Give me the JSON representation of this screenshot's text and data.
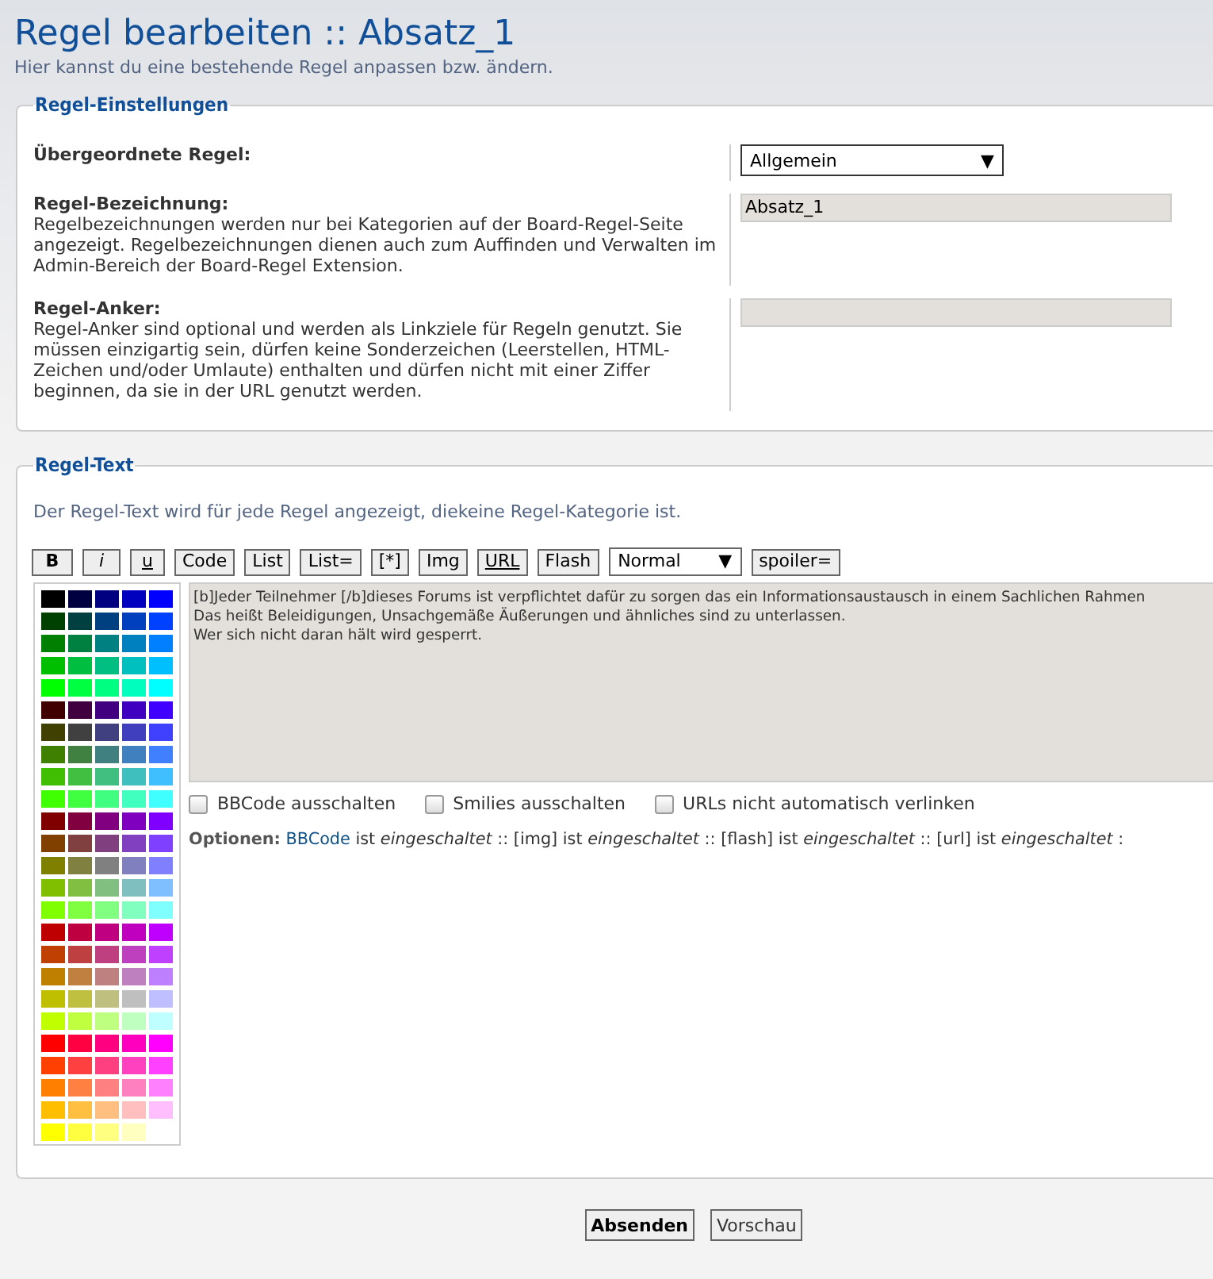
{
  "header": {
    "title": "Regel bearbeiten :: Absatz_1",
    "subtitle": "Hier kannst du eine bestehende Regel anpassen bzw. ändern."
  },
  "settings": {
    "legend": "Regel-Einstellungen",
    "rows": [
      {
        "kind": "select",
        "label": "Übergeordnete Regel:",
        "value": "Allgemein",
        "arrow": "▼"
      },
      {
        "kind": "text",
        "label": "Regel-Bezeichnung:",
        "explain": "Regelbezeichnungen werden nur bei Kategorien auf der Board-Regel-Seite angezeigt. Regelbezeichnungen dienen auch zum Auffinden und Verwalten im Admin-Bereich der Board-Regel Extension.",
        "value": "Absatz_1"
      },
      {
        "kind": "text",
        "label": "Regel-Anker:",
        "explain": "Regel-Anker sind optional und werden als Linkziele für Regeln genutzt. Sie müssen einzigartig sein, dürfen keine Sonderzeichen (Leerstellen, HTML-Zeichen und/oder Umlaute) enthalten und dürfen nicht mit einer Ziffer beginnen, da sie in der URL genutzt werden."
      }
    ]
  },
  "text_panel": {
    "legend": "Regel-Text",
    "explain": "Der Regel-Text wird für jede Regel angezeigt, diekeine Regel-Kategorie ist.",
    "toolbar": [
      {
        "kind": "bold",
        "label": "B"
      },
      {
        "kind": "italic",
        "label": "i"
      },
      {
        "kind": "underline",
        "label": "u"
      },
      {
        "kind": "plain",
        "label": "Code"
      },
      {
        "kind": "plain",
        "label": "List"
      },
      {
        "kind": "plain",
        "label": "List="
      },
      {
        "kind": "plain",
        "label": "[*]"
      },
      {
        "kind": "plain",
        "label": "Img"
      },
      {
        "kind": "underline",
        "label": "URL"
      },
      {
        "kind": "plain",
        "label": "Flash"
      },
      {
        "kind": "select",
        "label": "Normal",
        "arrow": "▼"
      },
      {
        "kind": "plain",
        "label": "spoiler="
      }
    ],
    "palette": [
      {
        "swatches": [
          {
            "color": "#000000"
          },
          {
            "color": "#000040"
          },
          {
            "color": "#000080"
          },
          {
            "color": "#0000bf"
          },
          {
            "color": "#0000ff"
          }
        ]
      },
      {
        "swatches": [
          {
            "color": "#004000"
          },
          {
            "color": "#004040"
          },
          {
            "color": "#004080"
          },
          {
            "color": "#0040bf"
          },
          {
            "color": "#0040ff"
          }
        ]
      },
      {
        "swatches": [
          {
            "color": "#008000"
          },
          {
            "color": "#008040"
          },
          {
            "color": "#008080"
          },
          {
            "color": "#0080bf"
          },
          {
            "color": "#0080ff"
          }
        ]
      },
      {
        "swatches": [
          {
            "color": "#00bf00"
          },
          {
            "color": "#00bf40"
          },
          {
            "color": "#00bf80"
          },
          {
            "color": "#00bfbf"
          },
          {
            "color": "#00bfff"
          }
        ]
      },
      {
        "swatches": [
          {
            "color": "#00ff00"
          },
          {
            "color": "#00ff40"
          },
          {
            "color": "#00ff80"
          },
          {
            "color": "#00ffbf"
          },
          {
            "color": "#00ffff"
          }
        ]
      },
      {
        "swatches": [
          {
            "color": "#400000"
          },
          {
            "color": "#400040"
          },
          {
            "color": "#400080"
          },
          {
            "color": "#4000bf"
          },
          {
            "color": "#4000ff"
          }
        ]
      },
      {
        "swatches": [
          {
            "color": "#404000"
          },
          {
            "color": "#404040"
          },
          {
            "color": "#404080"
          },
          {
            "color": "#4040bf"
          },
          {
            "color": "#4040ff"
          }
        ]
      },
      {
        "swatches": [
          {
            "color": "#408000"
          },
          {
            "color": "#408040"
          },
          {
            "color": "#408080"
          },
          {
            "color": "#4080bf"
          },
          {
            "color": "#4080ff"
          }
        ]
      },
      {
        "swatches": [
          {
            "color": "#40bf00"
          },
          {
            "color": "#40bf40"
          },
          {
            "color": "#40bf80"
          },
          {
            "color": "#40bfbf"
          },
          {
            "color": "#40bfff"
          }
        ]
      },
      {
        "swatches": [
          {
            "color": "#40ff00"
          },
          {
            "color": "#40ff40"
          },
          {
            "color": "#40ff80"
          },
          {
            "color": "#40ffbf"
          },
          {
            "color": "#40ffff"
          }
        ]
      },
      {
        "swatches": [
          {
            "color": "#800000"
          },
          {
            "color": "#800040"
          },
          {
            "color": "#800080"
          },
          {
            "color": "#8000bf"
          },
          {
            "color": "#8000ff"
          }
        ]
      },
      {
        "swatches": [
          {
            "color": "#804000"
          },
          {
            "color": "#804040"
          },
          {
            "color": "#804080"
          },
          {
            "color": "#8040bf"
          },
          {
            "color": "#8040ff"
          }
        ]
      },
      {
        "swatches": [
          {
            "color": "#808000"
          },
          {
            "color": "#808040"
          },
          {
            "color": "#808080"
          },
          {
            "color": "#8080bf"
          },
          {
            "color": "#8080ff"
          }
        ]
      },
      {
        "swatches": [
          {
            "color": "#80bf00"
          },
          {
            "color": "#80bf40"
          },
          {
            "color": "#80bf80"
          },
          {
            "color": "#80bfbf"
          },
          {
            "color": "#80bfff"
          }
        ]
      },
      {
        "swatches": [
          {
            "color": "#80ff00"
          },
          {
            "color": "#80ff40"
          },
          {
            "color": "#80ff80"
          },
          {
            "color": "#80ffbf"
          },
          {
            "color": "#80ffff"
          }
        ]
      },
      {
        "swatches": [
          {
            "color": "#bf0000"
          },
          {
            "color": "#bf0040"
          },
          {
            "color": "#bf0080"
          },
          {
            "color": "#bf00bf"
          },
          {
            "color": "#bf00ff"
          }
        ]
      },
      {
        "swatches": [
          {
            "color": "#bf4000"
          },
          {
            "color": "#bf4040"
          },
          {
            "color": "#bf4080"
          },
          {
            "color": "#bf40bf"
          },
          {
            "color": "#bf40ff"
          }
        ]
      },
      {
        "swatches": [
          {
            "color": "#bf8000"
          },
          {
            "color": "#bf8040"
          },
          {
            "color": "#bf8080"
          },
          {
            "color": "#bf80bf"
          },
          {
            "color": "#bf80ff"
          }
        ]
      },
      {
        "swatches": [
          {
            "color": "#bfbf00"
          },
          {
            "color": "#bfbf40"
          },
          {
            "color": "#bfbf80"
          },
          {
            "color": "#bfbfbf"
          },
          {
            "color": "#bfbfff"
          }
        ]
      },
      {
        "swatches": [
          {
            "color": "#bfff00"
          },
          {
            "color": "#bfff40"
          },
          {
            "color": "#bfff80"
          },
          {
            "color": "#bfffbf"
          },
          {
            "color": "#bfffff"
          }
        ]
      },
      {
        "swatches": [
          {
            "color": "#ff0000"
          },
          {
            "color": "#ff0040"
          },
          {
            "color": "#ff0080"
          },
          {
            "color": "#ff00bf"
          },
          {
            "color": "#ff00ff"
          }
        ]
      },
      {
        "swatches": [
          {
            "color": "#ff4000"
          },
          {
            "color": "#ff4040"
          },
          {
            "color": "#ff4080"
          },
          {
            "color": "#ff40bf"
          },
          {
            "color": "#ff40ff"
          }
        ]
      },
      {
        "swatches": [
          {
            "color": "#ff8000"
          },
          {
            "color": "#ff8040"
          },
          {
            "color": "#ff8080"
          },
          {
            "color": "#ff80bf"
          },
          {
            "color": "#ff80ff"
          }
        ]
      },
      {
        "swatches": [
          {
            "color": "#ffbf00"
          },
          {
            "color": "#ffbf40"
          },
          {
            "color": "#ffbf80"
          },
          {
            "color": "#ffbfbf"
          },
          {
            "color": "#ffbfff"
          }
        ]
      },
      {
        "swatches": [
          {
            "color": "#ffff00"
          },
          {
            "color": "#ffff40"
          },
          {
            "color": "#ffff80"
          },
          {
            "color": "#ffffbf"
          }
        ]
      }
    ],
    "lines": [
      "[b]Jeder Teilnehmer [/b]dieses Forums ist verpflichtet dafür zu sorgen das ein Informationsaustausch in einem Sachlichen Rahmen",
      "Das heißt Beleidigungen, Unsachgemäße Äußerungen und ähnliches sind zu unterlassen.",
      "Wer sich nicht daran hält wird gesperrt."
    ],
    "checkboxes": [
      {
        "label": "BBCode ausschalten",
        "checked": false
      },
      {
        "label": "Smilies ausschalten",
        "checked": false
      },
      {
        "label": "URLs nicht automatisch verlinken",
        "checked": false
      }
    ],
    "options": {
      "label": "Optionen:",
      "link": "BBCode",
      "text": "ist *eingeschaltet* :: [img] ist *eingeschaltet* :: [flash] ist *eingeschaltet* :: [url] ist *eingeschaltet* :"
    }
  },
  "buttons": [
    {
      "kind": "primary",
      "label": "Absenden"
    },
    {
      "kind": "secondary",
      "label": "Vorschau"
    }
  ]
}
